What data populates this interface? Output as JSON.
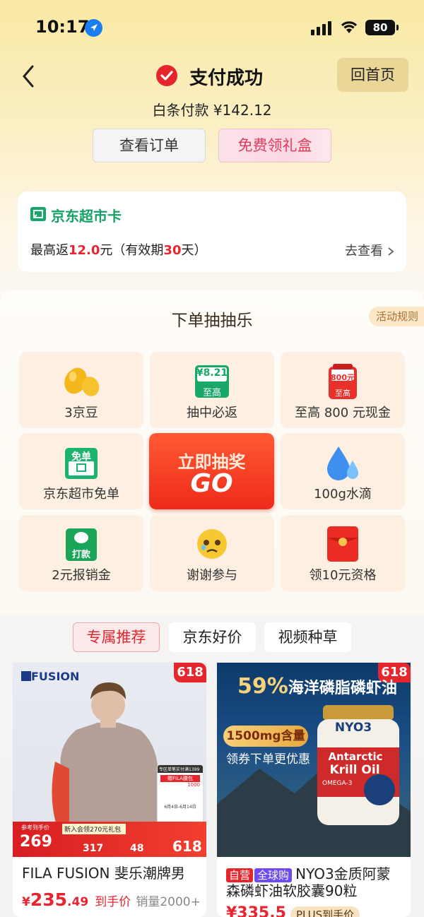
{
  "status_bar": {
    "time": "10:17",
    "battery": "80"
  },
  "header": {
    "title": "支付成功",
    "home_button": "回首页",
    "payment_line": "白条付款 ¥142.12",
    "view_order_button": "查看订单",
    "free_gift_button": "免费领礼盒"
  },
  "supermarket_card": {
    "title": "京东超市卡",
    "desc_prefix": "最高返",
    "desc_amount": "12.0",
    "desc_mid": "元（有效期",
    "desc_days": "30",
    "desc_suffix": "天）",
    "link": "去查看"
  },
  "lottery": {
    "title": "下单抽抽乐",
    "rules": "活动规则",
    "cells": [
      {
        "label": "3京豆",
        "icon": "beans-icon"
      },
      {
        "label": "抽中必返",
        "icon": "coupon-icon",
        "badge_value": "¥8.21",
        "badge_sub": "至高"
      },
      {
        "label": "至高 800 元现金",
        "icon": "cash-bag-icon",
        "badge_value": "800元",
        "badge_sub": "至高"
      },
      {
        "label": "京东超市免单",
        "icon": "free-order-icon",
        "badge_value": "免单"
      },
      {
        "label": "100g水滴",
        "icon": "water-drop-icon"
      },
      {
        "label": "2元报销金",
        "icon": "reimburse-icon",
        "badge_value": "打款"
      },
      {
        "label": "谢谢参与",
        "icon": "sad-face-icon"
      },
      {
        "label": "领10元资格",
        "icon": "red-envelope-icon"
      }
    ],
    "go_button": {
      "line1": "立即抽奖",
      "line2": "GO"
    }
  },
  "tabs": [
    "专属推荐",
    "京东好价",
    "视频种草"
  ],
  "products": [
    {
      "brand": "FUSION",
      "tag": "618",
      "promo_price": "269",
      "promo_label": "参考到手价",
      "promo_gift": "新入会领270元礼包",
      "promo_values": [
        "317",
        "48",
        "618"
      ],
      "promo_box_title": "专区单笔实付满1399",
      "promo_box_gift": "赠FILA腰包",
      "promo_box_price": "1000",
      "promo_box_note": "6月4日-6月14日",
      "name": "FILA FUSION 斐乐潮牌男",
      "price_symbol": "¥",
      "price_int": "235",
      "price_dec": ".49",
      "price_tag": "到手价",
      "sales": "销量2000+"
    },
    {
      "tag": "618",
      "headline_pct": "59%",
      "headline": "海洋磷脂磷虾油",
      "content_badge": "1500mg含量",
      "coupon_line": "领券下单更优惠",
      "bottle_brand": "NYO3",
      "bottle_name1": "Antarctic",
      "bottle_name2": "Krill Oil",
      "bottle_sub": "OMEGA-3",
      "badge_self": "自营",
      "badge_global": "全球购",
      "name_line1": "NYO3金质阿蒙",
      "name_line2": "森磷虾油软胶囊90粒",
      "price_visible": "¥335.5",
      "plus_tag": "PLUS到手价"
    }
  ],
  "colors": {
    "accent_red": "#e8242f",
    "green": "#15a064",
    "gold": "#f9e9a4"
  }
}
